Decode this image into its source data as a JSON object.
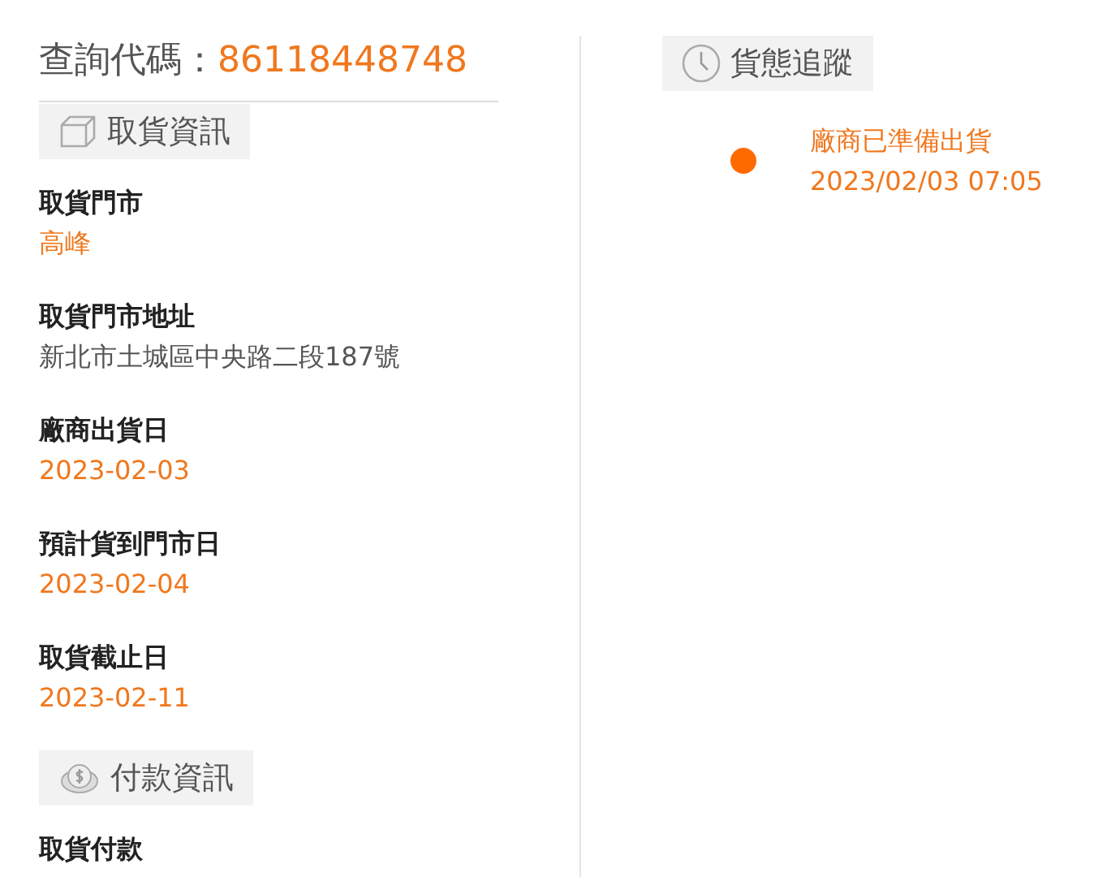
{
  "query": {
    "label": "查詢代碼：",
    "code": "86118448748"
  },
  "sections": [
    {
      "kind": "box",
      "title": "取貨資訊",
      "fields": [
        {
          "label": "取貨門市",
          "value": "高峰",
          "highlight": true
        },
        {
          "label": "取貨門市地址",
          "value": "新北市土城區中央路二段187號",
          "highlight": false
        },
        {
          "label": "廠商出貨日",
          "value": "2023-02-03",
          "highlight": true
        },
        {
          "label": "預計貨到門市日",
          "value": "2023-02-04",
          "highlight": true
        },
        {
          "label": "取貨截止日",
          "value": "2023-02-11",
          "highlight": true
        }
      ]
    },
    {
      "kind": "coin",
      "title": "付款資訊",
      "fields": [
        {
          "label": "取貨付款"
        }
      ]
    }
  ],
  "tracking": {
    "kind": "clock",
    "title": "貨態追蹤",
    "events": [
      {
        "status": "廠商已準備出貨",
        "time": "2023/02/03 07:05"
      }
    ]
  }
}
